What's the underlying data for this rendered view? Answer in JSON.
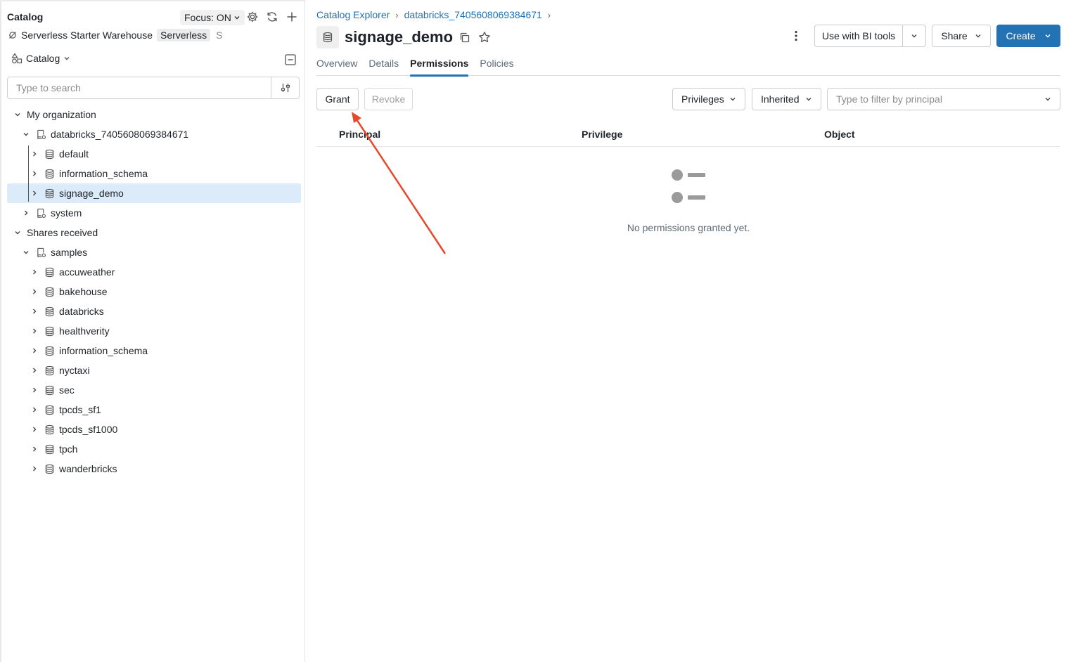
{
  "sidebar": {
    "title": "Catalog",
    "focus_label": "Focus: ON",
    "warehouse_name": "Serverless Starter Warehouse",
    "warehouse_type": "Serverless",
    "warehouse_suffix": "S",
    "catalog_selector": "Catalog",
    "search_placeholder": "Type to search",
    "tree": [
      {
        "label": "My organization",
        "depth": 0,
        "expanded": true,
        "icon": "none"
      },
      {
        "label": "databricks_7405608069384671",
        "depth": 1,
        "expanded": true,
        "icon": "catalog-icon"
      },
      {
        "label": "default",
        "depth": 2,
        "expanded": false,
        "icon": "schema-icon"
      },
      {
        "label": "information_schema",
        "depth": 2,
        "expanded": false,
        "icon": "schema-icon"
      },
      {
        "label": "signage_demo",
        "depth": 2,
        "expanded": false,
        "icon": "schema-icon",
        "selected": true
      },
      {
        "label": "system",
        "depth": 1,
        "expanded": false,
        "icon": "catalog-icon"
      },
      {
        "label": "Shares received",
        "depth": 0,
        "expanded": true,
        "icon": "none"
      },
      {
        "label": "samples",
        "depth": 1,
        "expanded": true,
        "icon": "catalog-icon"
      },
      {
        "label": "accuweather",
        "depth": 2,
        "expanded": false,
        "icon": "schema-icon"
      },
      {
        "label": "bakehouse",
        "depth": 2,
        "expanded": false,
        "icon": "schema-icon"
      },
      {
        "label": "databricks",
        "depth": 2,
        "expanded": false,
        "icon": "schema-icon"
      },
      {
        "label": "healthverity",
        "depth": 2,
        "expanded": false,
        "icon": "schema-icon"
      },
      {
        "label": "information_schema",
        "depth": 2,
        "expanded": false,
        "icon": "schema-icon"
      },
      {
        "label": "nyctaxi",
        "depth": 2,
        "expanded": false,
        "icon": "schema-icon"
      },
      {
        "label": "sec",
        "depth": 2,
        "expanded": false,
        "icon": "schema-icon"
      },
      {
        "label": "tpcds_sf1",
        "depth": 2,
        "expanded": false,
        "icon": "schema-icon"
      },
      {
        "label": "tpcds_sf1000",
        "depth": 2,
        "expanded": false,
        "icon": "schema-icon"
      },
      {
        "label": "tpch",
        "depth": 2,
        "expanded": false,
        "icon": "schema-icon"
      },
      {
        "label": "wanderbricks",
        "depth": 2,
        "expanded": false,
        "icon": "schema-icon"
      }
    ]
  },
  "main": {
    "breadcrumb": [
      "Catalog Explorer",
      "databricks_7405608069384671"
    ],
    "title": "signage_demo",
    "buttons": {
      "bi_tools": "Use with BI tools",
      "share": "Share",
      "create": "Create",
      "grant": "Grant",
      "revoke": "Revoke"
    },
    "tabs": [
      {
        "label": "Overview",
        "active": false
      },
      {
        "label": "Details",
        "active": false
      },
      {
        "label": "Permissions",
        "active": true
      },
      {
        "label": "Policies",
        "active": false
      }
    ],
    "filters": {
      "privileges": "Privileges",
      "inherited": "Inherited",
      "principal_placeholder": "Type to filter by principal"
    },
    "table": {
      "columns": [
        "Principal",
        "Privilege",
        "Object"
      ],
      "empty_text": "No permissions granted yet."
    }
  },
  "colors": {
    "accent": "#2272b4",
    "selected_row": "#dcebfa",
    "annotation_arrow": "#e8482c"
  }
}
